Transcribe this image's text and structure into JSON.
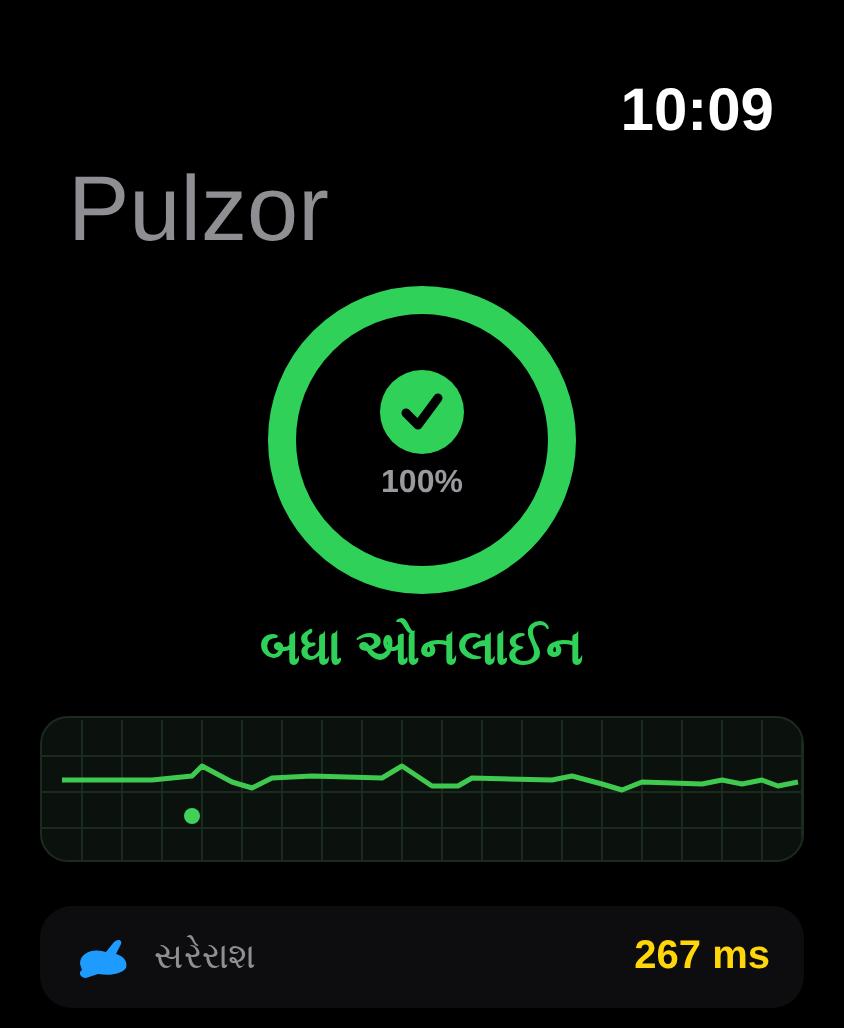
{
  "status_bar": {
    "time": "10:09"
  },
  "app": {
    "title": "Pulzor"
  },
  "ring": {
    "level": 1,
    "percent": "100%",
    "status": "બધા ઓનલાઈન"
  },
  "stats": [
    {
      "label": "સરેરાશ",
      "value": "267 ms"
    }
  ]
}
